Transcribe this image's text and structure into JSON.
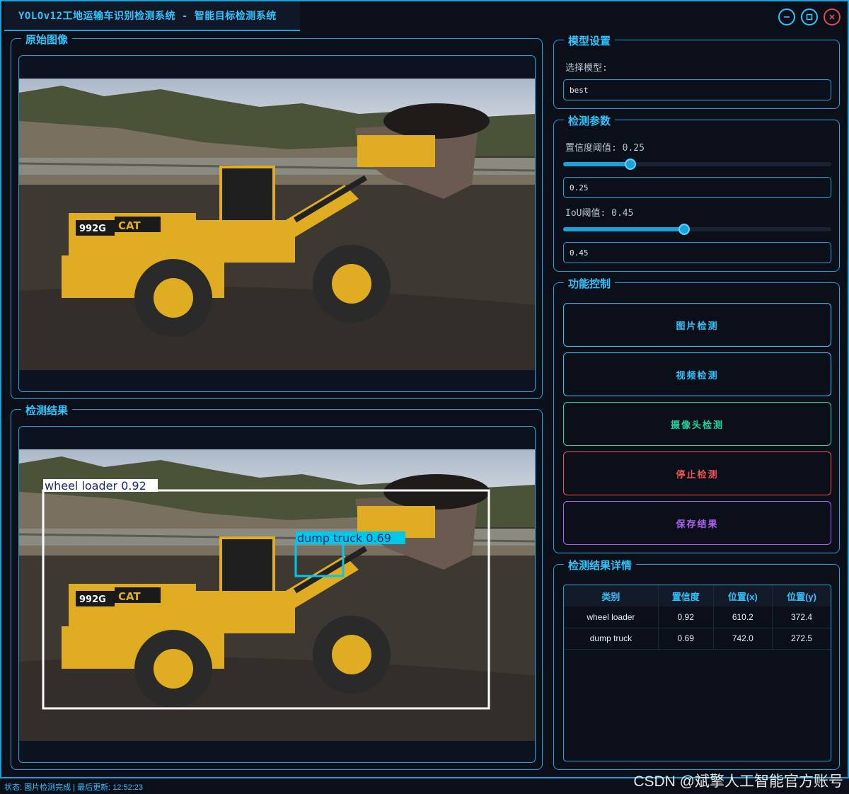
{
  "window": {
    "title": "YOLOv12工地运输车识别检测系统 - 智能目标检测系统",
    "controls": {
      "minimize": "minimize-icon",
      "maximize": "maximize-icon",
      "close": "close-icon"
    }
  },
  "original_panel": {
    "title": "原始图像",
    "image": {
      "vehicle_model": "992G",
      "brand": "CAT"
    }
  },
  "result_panel": {
    "title": "检测结果",
    "detections": [
      {
        "label": "wheel loader 0.92",
        "color": "#ffffff"
      },
      {
        "label": "dump truck 0.69",
        "color": "#00c8e8"
      }
    ]
  },
  "model_settings": {
    "title": "模型设置",
    "select_label": "选择模型:",
    "selected_model": "best"
  },
  "params": {
    "title": "检测参数",
    "confidence_label": "置信度阈值: 0.25",
    "confidence_value": "0.25",
    "confidence_level": 0.25,
    "iou_label": "IoU阈值: 0.45",
    "iou_value": "0.45",
    "iou_level": 0.45
  },
  "controls": {
    "title": "功能控制",
    "buttons": [
      {
        "label": "图片检测",
        "color": "#2ec5ff"
      },
      {
        "label": "视频检测",
        "color": "#2ec5ff"
      },
      {
        "label": "摄像头检测",
        "color": "#21d6a0"
      },
      {
        "label": "停止检测",
        "color": "#f05454"
      },
      {
        "label": "保存结果",
        "color": "#b061f5"
      }
    ]
  },
  "details": {
    "title": "检测结果详情",
    "columns": [
      "类别",
      "置信度",
      "位置(x)",
      "位置(y)"
    ],
    "rows": [
      [
        "wheel loader",
        "0.92",
        "610.2",
        "372.4"
      ],
      [
        "dump truck",
        "0.69",
        "742.0",
        "272.5"
      ]
    ]
  },
  "status": {
    "text": "状态: 图片检测完成 | 最后更新: 12:52:23"
  },
  "watermark": "CSDN @斌擎人工智能官方账号",
  "colors": {
    "accent": "#1aa3d9",
    "background": "#0b0f1a"
  }
}
